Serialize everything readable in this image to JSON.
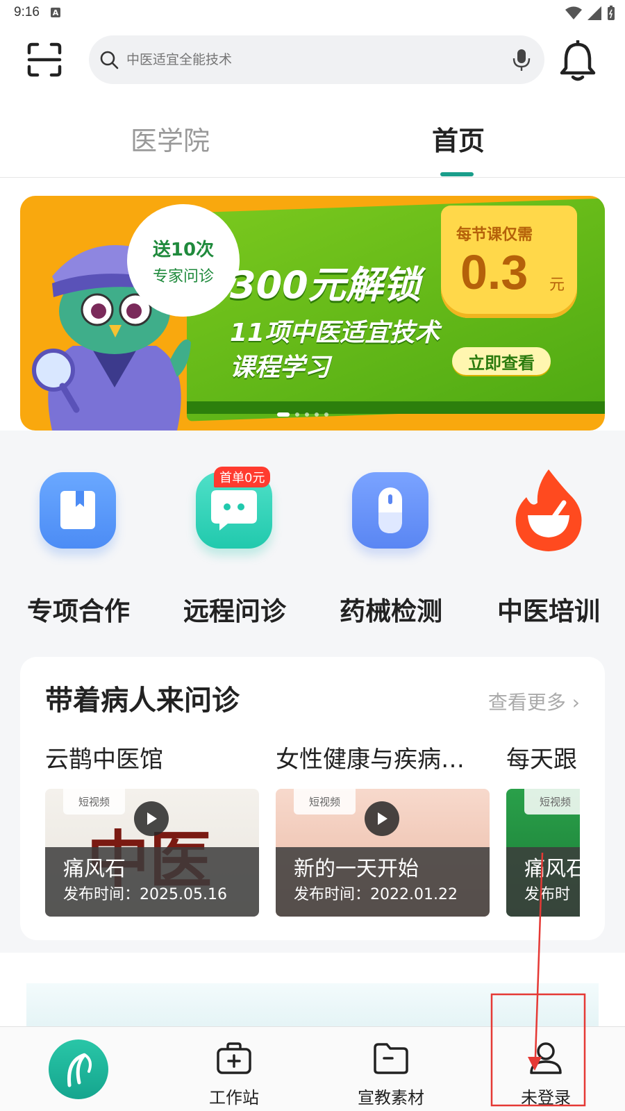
{
  "status_bar": {
    "time": "9:16",
    "app_badge": "A"
  },
  "search": {
    "placeholder": "中医适宜全能技术"
  },
  "tabs": [
    {
      "label": "医学院"
    },
    {
      "label": "首页"
    }
  ],
  "banner": {
    "seal_line1": "送10次",
    "seal_line2": "专家问诊",
    "title": "300元解锁",
    "subtitle1": "11项中医适宜技术",
    "subtitle2": "课程学习",
    "price_caption": "每节课仅需",
    "price_value": "0.3",
    "price_unit": "元",
    "cta": "立即查看",
    "slide_count": 5,
    "active_slide": 1
  },
  "features": [
    {
      "label": "专项合作",
      "icon": "book-icon"
    },
    {
      "label": "远程问诊",
      "icon": "chat-bubble-icon",
      "badge": "首单0元"
    },
    {
      "label": "药械检测",
      "icon": "capsule-icon"
    },
    {
      "label": "中医培训",
      "icon": "flame-bowl-icon"
    }
  ],
  "consult_section": {
    "title": "带着病人来问诊",
    "see_more": "查看更多",
    "doctors": [
      "云鹊中医馆",
      "女性健康与疾病…",
      "每天跟"
    ],
    "clips": [
      {
        "chip": "短视频",
        "title": "痛风石",
        "date": "发布时间：2025.05.16",
        "thumb_text": "中医"
      },
      {
        "chip": "短视频",
        "title": "新的一天开始",
        "date": "发布时间：2022.01.22"
      },
      {
        "chip": "短视频",
        "title": "痛风石",
        "date": "发布时"
      }
    ]
  },
  "bottom_nav": [
    {
      "label": "",
      "icon": "home-logo-icon"
    },
    {
      "label": "工作站",
      "icon": "medkit-icon"
    },
    {
      "label": "宣教素材",
      "icon": "folder-icon"
    },
    {
      "label": "未登录",
      "icon": "user-icon"
    }
  ],
  "colors": {
    "accent": "#1a9e8b",
    "banner_orange": "#f9a80e",
    "banner_green": "#5cb31a",
    "annotation_red": "#e53935"
  }
}
